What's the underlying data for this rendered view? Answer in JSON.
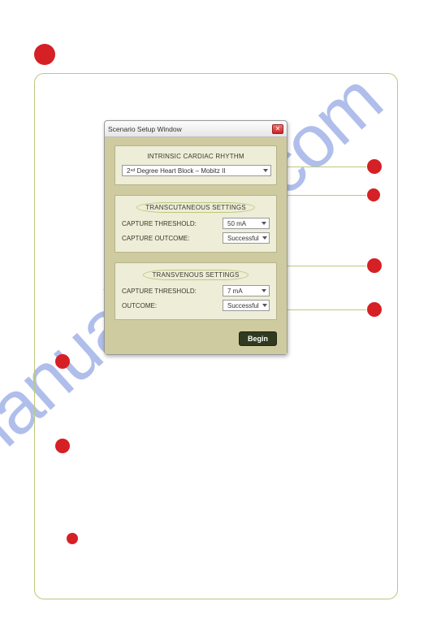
{
  "watermark": "manualshive.com",
  "dialog": {
    "title": "Scenario Setup Window",
    "panel1": {
      "title": "INTRINSIC CARDIAC RHYTHM",
      "select": "2ⁿᵈ Degree Heart Block – Mobitz II"
    },
    "panel2": {
      "title": "TRANSCUTANEOUS SETTINGS",
      "row1_label": "CAPTURE THRESHOLD:",
      "row1_value": "50 mA",
      "row2_label": "CAPTURE OUTCOME:",
      "row2_value": "Successful"
    },
    "panel3": {
      "title": "TRANSVENOUS SETTINGS",
      "row1_label": "CAPTURE THRESHOLD:",
      "row1_value": "7 mA",
      "row2_label": "OUTCOME:",
      "row2_value": "Successful"
    },
    "begin": "Begin"
  }
}
